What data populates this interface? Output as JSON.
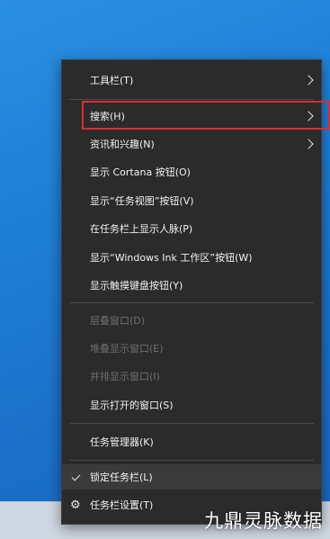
{
  "menu": {
    "items": [
      {
        "label": "工具栏(T)"
      },
      {
        "label": "搜索(H)"
      },
      {
        "label": "资讯和兴趣(N)"
      },
      {
        "label": "显示 Cortana 按钮(O)"
      },
      {
        "label": "显示“任务视图”按钮(V)"
      },
      {
        "label": "在任务栏上显示人脉(P)"
      },
      {
        "label": "显示“Windows Ink 工作区”按钮(W)"
      },
      {
        "label": "显示触摸键盘按钮(Y)"
      },
      {
        "label": "层叠窗口(D)"
      },
      {
        "label": "堆叠显示窗口(E)"
      },
      {
        "label": "并排显示窗口(I)"
      },
      {
        "label": "显示打开的窗口(S)"
      },
      {
        "label": "任务管理器(K)"
      },
      {
        "label": "锁定任务栏(L)"
      },
      {
        "label": "任务栏设置(T)"
      }
    ]
  },
  "watermark": "九鼎灵脉数据",
  "colors": {
    "highlight_border": "#e02b2b",
    "menu_bg": "#2b2b2b"
  }
}
